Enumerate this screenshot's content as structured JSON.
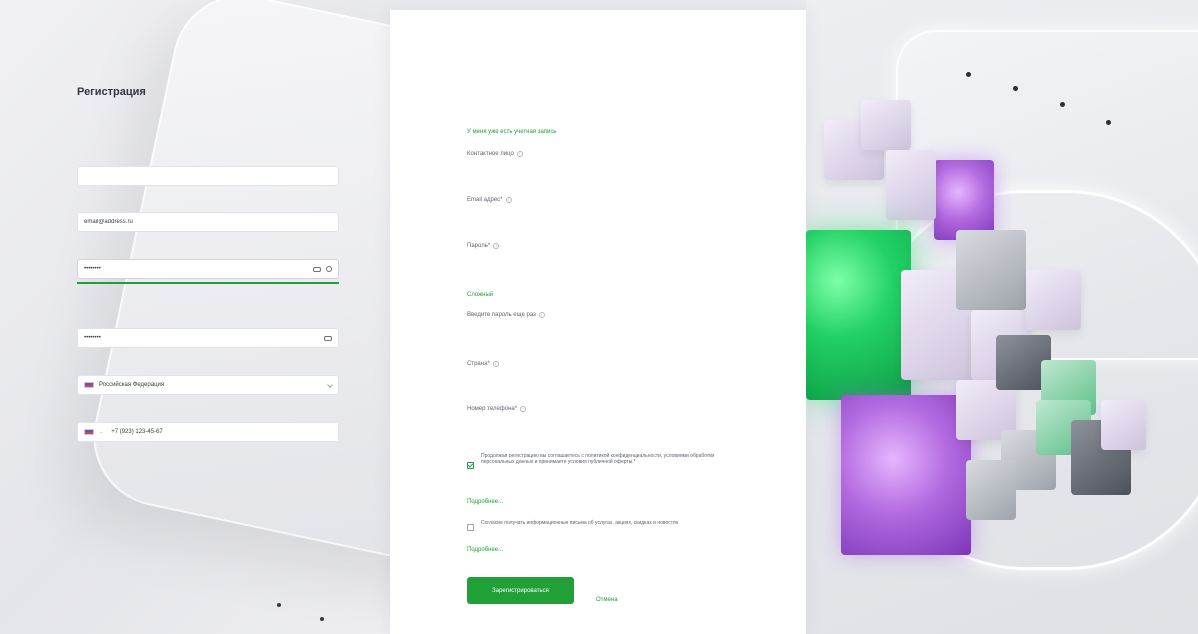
{
  "form": {
    "title": "Регистрация",
    "login_link": "У меня уже есть учетная запись",
    "contact_label": "Контактное лицо",
    "contact_value": "",
    "email_label": "Email адрес*",
    "email_value": "email@address.ru",
    "password_label": "Пароль*",
    "password_value": "••••••••",
    "password_strength": "Сложный",
    "password_strength_level": 1.0,
    "repeat_label": "Введите пароль еще раз",
    "repeat_value": "••••••••",
    "country_label": "Страна*",
    "country_value": "Российская Федерация",
    "phone_label": "Номер телефона*",
    "phone_value": "+7 (923) 123-45-67",
    "consent_text": "Продолжая регистрацию вы соглашаетесь с политикой конфиденциальности, условиями обработки персональных данных и принимаете условия публичной оферты.*",
    "consent_checked": true,
    "more_link_1": "Подробнее...",
    "news_text": "Согласие получать информационные письма об услугах, акциях, скидках и новостях",
    "news_checked": false,
    "more_link_2": "Подробнее...",
    "submit_label": "Зарегистрироваться",
    "cancel_label": "Отмена"
  },
  "colors": {
    "accent": "#21a038",
    "card_bg": "#ffffff",
    "page_bg": "#e9eaee"
  }
}
